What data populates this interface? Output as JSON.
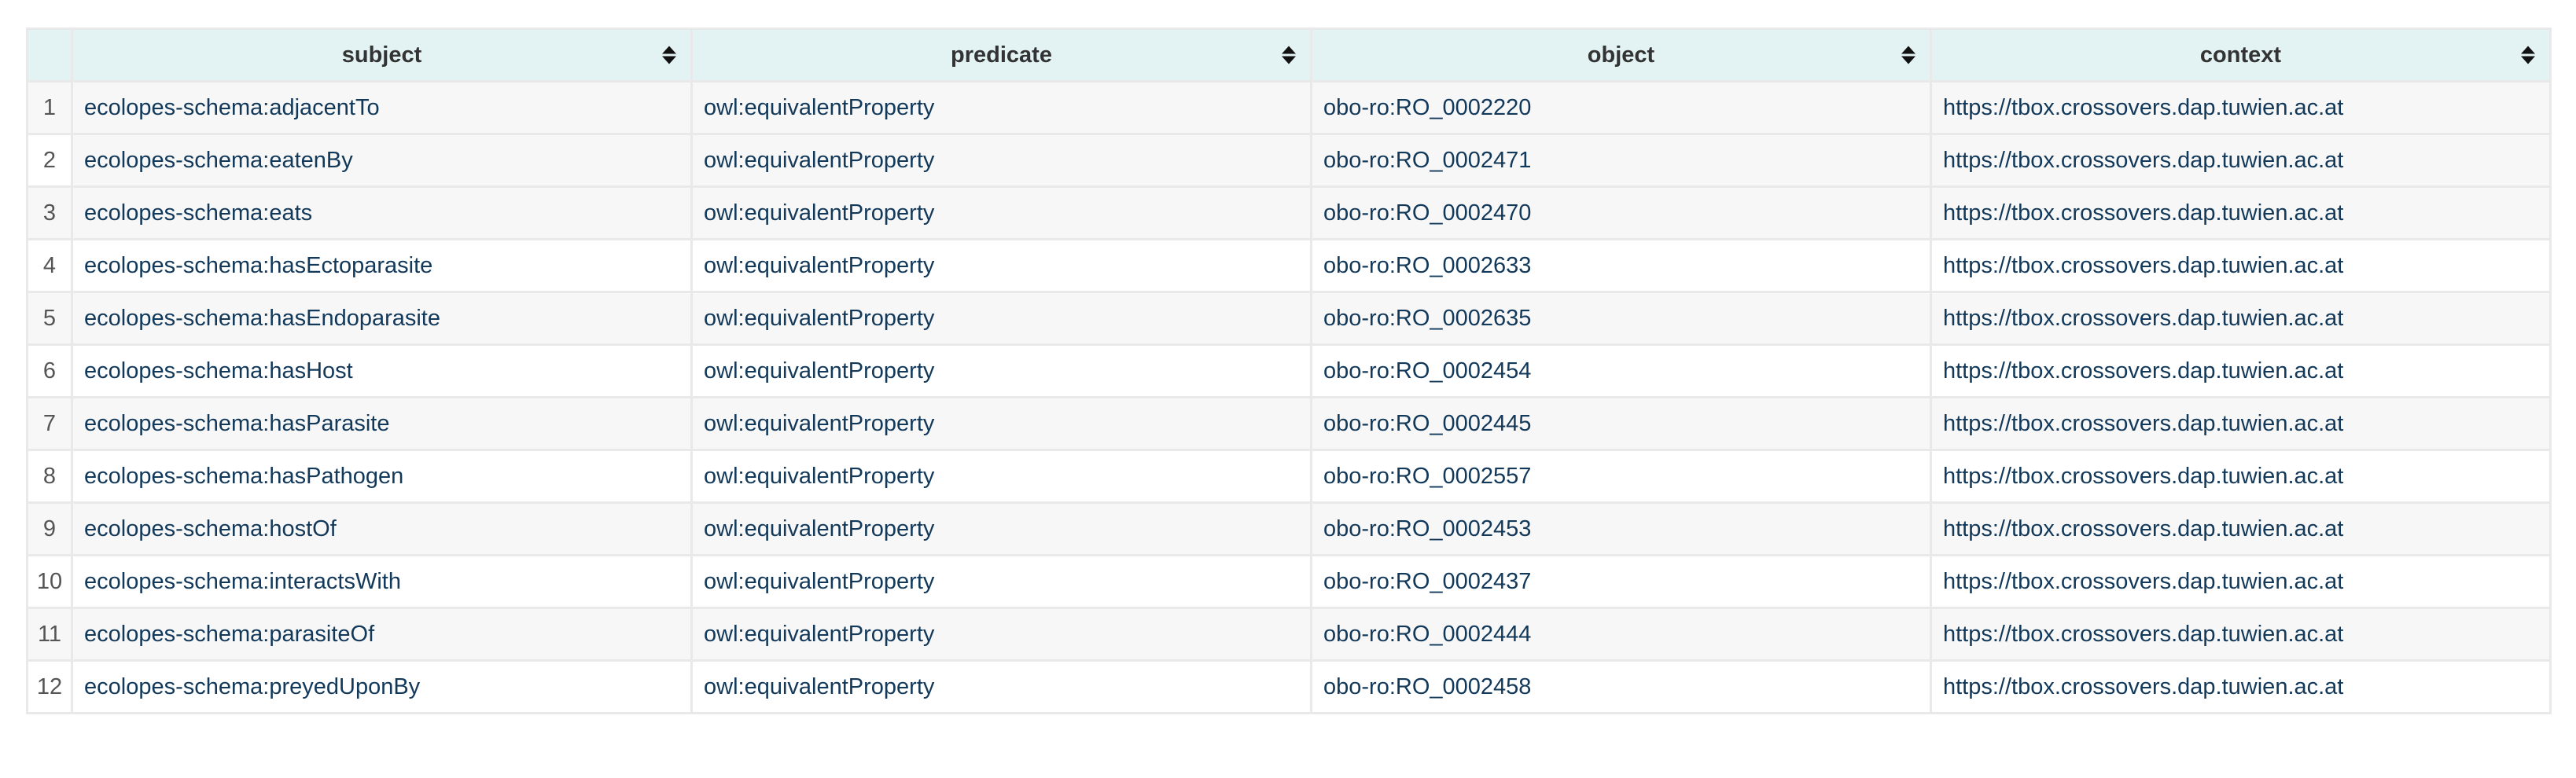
{
  "columns": [
    "subject",
    "predicate",
    "object",
    "context"
  ],
  "rows": [
    {
      "n": "1",
      "subject": "ecolopes-schema:adjacentTo",
      "predicate": "owl:equivalentProperty",
      "object": "obo-ro:RO_0002220",
      "context": "https://tbox.crossovers.dap.tuwien.ac.at"
    },
    {
      "n": "2",
      "subject": "ecolopes-schema:eatenBy",
      "predicate": "owl:equivalentProperty",
      "object": "obo-ro:RO_0002471",
      "context": "https://tbox.crossovers.dap.tuwien.ac.at"
    },
    {
      "n": "3",
      "subject": "ecolopes-schema:eats",
      "predicate": "owl:equivalentProperty",
      "object": "obo-ro:RO_0002470",
      "context": "https://tbox.crossovers.dap.tuwien.ac.at"
    },
    {
      "n": "4",
      "subject": "ecolopes-schema:hasEctoparasite",
      "predicate": "owl:equivalentProperty",
      "object": "obo-ro:RO_0002633",
      "context": "https://tbox.crossovers.dap.tuwien.ac.at"
    },
    {
      "n": "5",
      "subject": "ecolopes-schema:hasEndoparasite",
      "predicate": "owl:equivalentProperty",
      "object": "obo-ro:RO_0002635",
      "context": "https://tbox.crossovers.dap.tuwien.ac.at"
    },
    {
      "n": "6",
      "subject": "ecolopes-schema:hasHost",
      "predicate": "owl:equivalentProperty",
      "object": "obo-ro:RO_0002454",
      "context": "https://tbox.crossovers.dap.tuwien.ac.at"
    },
    {
      "n": "7",
      "subject": "ecolopes-schema:hasParasite",
      "predicate": "owl:equivalentProperty",
      "object": "obo-ro:RO_0002445",
      "context": "https://tbox.crossovers.dap.tuwien.ac.at"
    },
    {
      "n": "8",
      "subject": "ecolopes-schema:hasPathogen",
      "predicate": "owl:equivalentProperty",
      "object": "obo-ro:RO_0002557",
      "context": "https://tbox.crossovers.dap.tuwien.ac.at"
    },
    {
      "n": "9",
      "subject": "ecolopes-schema:hostOf",
      "predicate": "owl:equivalentProperty",
      "object": "obo-ro:RO_0002453",
      "context": "https://tbox.crossovers.dap.tuwien.ac.at"
    },
    {
      "n": "10",
      "subject": "ecolopes-schema:interactsWith",
      "predicate": "owl:equivalentProperty",
      "object": "obo-ro:RO_0002437",
      "context": "https://tbox.crossovers.dap.tuwien.ac.at"
    },
    {
      "n": "11",
      "subject": "ecolopes-schema:parasiteOf",
      "predicate": "owl:equivalentProperty",
      "object": "obo-ro:RO_0002444",
      "context": "https://tbox.crossovers.dap.tuwien.ac.at"
    },
    {
      "n": "12",
      "subject": "ecolopes-schema:preyedUponBy",
      "predicate": "owl:equivalentProperty",
      "object": "obo-ro:RO_0002458",
      "context": "https://tbox.crossovers.dap.tuwien.ac.at"
    }
  ],
  "colors": {
    "header_bg": "#e3f3f3",
    "text": "#12385a",
    "stripe": "#f7f7f7"
  }
}
